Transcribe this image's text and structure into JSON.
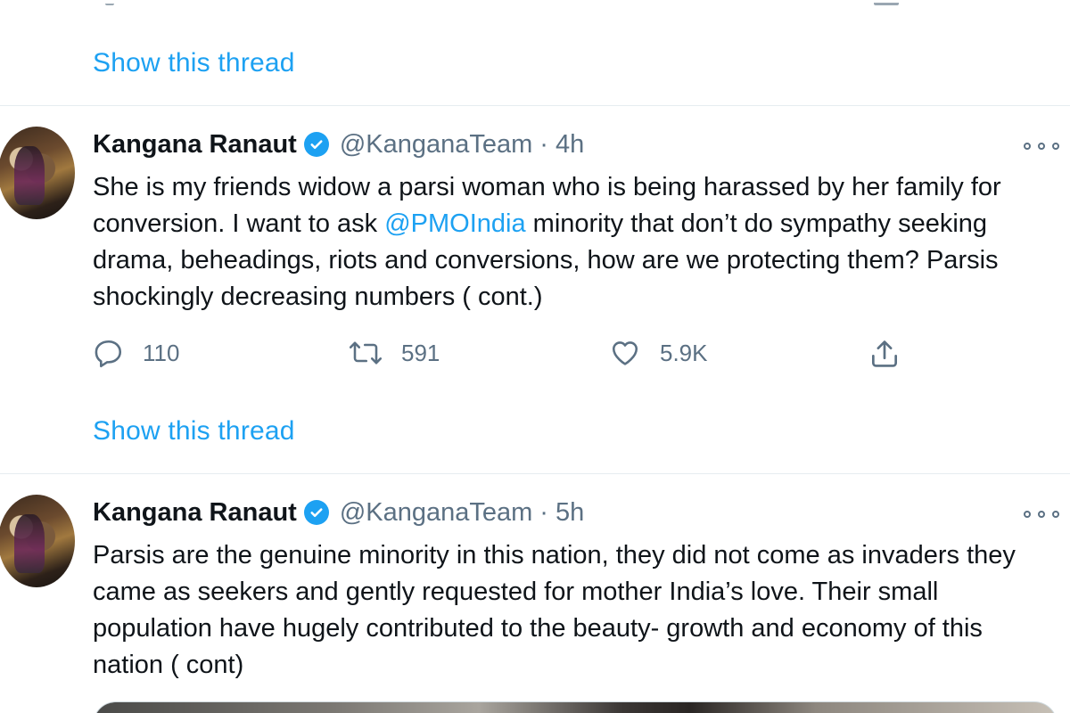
{
  "thread_links": [
    {
      "label": "Show this thread"
    },
    {
      "label": "Show this thread"
    }
  ],
  "tweets": [
    {
      "author": {
        "name": "Kangana Ranaut",
        "handle": "@KanganaTeam",
        "time": "4h",
        "verified": true
      },
      "text": {
        "part1": "She is my friends widow a parsi woman who is being harassed by her family for conversion. I want to ask ",
        "mention": "@PMOIndia",
        "part2": " minority that don’t do sympathy seeking drama, beheadings, riots and conversions, how are we protecting them? Parsis shockingly decreasing numbers ( cont.)"
      },
      "actions": {
        "replies": "110",
        "retweets": "591",
        "likes": "5.9K"
      }
    },
    {
      "author": {
        "name": "Kangana Ranaut",
        "handle": "@KanganaTeam",
        "time": "5h",
        "verified": true
      },
      "text": {
        "part1": "Parsis are the genuine minority in this nation, they did not come as invaders they came as seekers and gently requested for mother India’s love. Their small population have hugely contributed to the beauty- growth and economy of this nation ( cont)"
      }
    }
  ],
  "separator": "·",
  "colors": {
    "accent": "#1da1f2",
    "secondary_text": "#5b7083",
    "primary_text": "#0f1419",
    "divider": "#e6ecf0"
  },
  "icons": [
    "reply-icon",
    "retweet-icon",
    "like-icon",
    "share-icon",
    "more-options-icon",
    "verified-badge-icon"
  ]
}
